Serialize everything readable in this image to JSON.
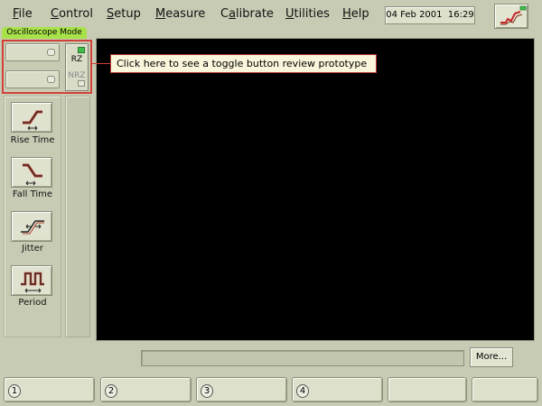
{
  "menubar": {
    "items": [
      {
        "pre": "",
        "u": "F",
        "post": "ile"
      },
      {
        "pre": "",
        "u": "C",
        "post": "ontrol"
      },
      {
        "pre": "",
        "u": "S",
        "post": "etup"
      },
      {
        "pre": "",
        "u": "M",
        "post": "easure"
      },
      {
        "pre": "C",
        "u": "a",
        "post": "librate"
      },
      {
        "pre": "",
        "u": "U",
        "post": "tilities"
      },
      {
        "pre": "",
        "u": "H",
        "post": "elp"
      }
    ],
    "date": "04 Feb 2001",
    "time": "16:29"
  },
  "mode_tab": "Oscilloscope Mode",
  "toggle": {
    "top": "RZ",
    "bottom": "NRZ"
  },
  "callout": "Click here to see a toggle button review prototype",
  "measurements": [
    {
      "label": "Rise Time",
      "icon": "rise-time-icon"
    },
    {
      "label": "Fall Time",
      "icon": "fall-time-icon"
    },
    {
      "label": "Jitter",
      "icon": "jitter-icon"
    },
    {
      "label": "Period",
      "icon": "period-icon"
    }
  ],
  "more_button": "More...",
  "softkeys": [
    {
      "num": "1"
    },
    {
      "num": "2"
    },
    {
      "num": "3"
    },
    {
      "num": "4"
    },
    {
      "num": ""
    },
    {
      "num": ""
    }
  ],
  "colors": {
    "mode_tab": "#a8e24a",
    "callout_border": "#b83a34",
    "screen": "#000000"
  }
}
